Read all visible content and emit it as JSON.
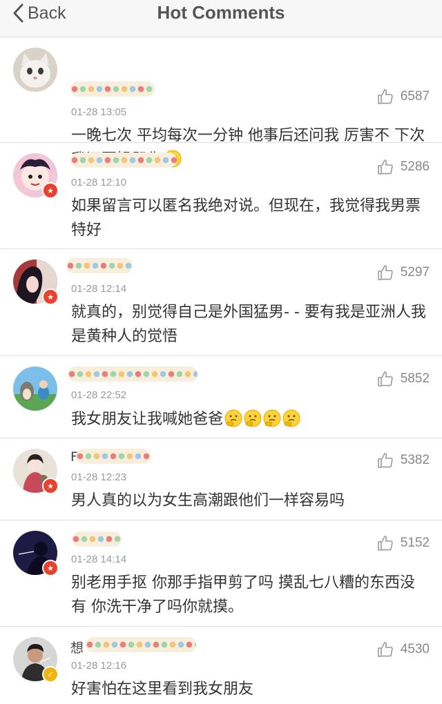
{
  "header": {
    "back_label": "Back",
    "title": "Hot Comments"
  },
  "comments": [
    {
      "time": "01-28 13:05",
      "likes": "6587",
      "text": "一晚七次 平均每次一分钟 他事后还问我 厉害不 下次我还要操哭你",
      "emoji": "smile",
      "emoji_count": 1,
      "badge": "",
      "name_prefix": ""
    },
    {
      "time": "01-28 12:10",
      "likes": "5286",
      "text": "如果留言可以匿名我绝对说。但现在，我觉得我男票特好",
      "emoji": "",
      "emoji_count": 0,
      "badge": "red",
      "name_prefix": ""
    },
    {
      "time": "01-28 12:14",
      "likes": "5297",
      "text": "就真的，别觉得自己是外国猛男- - 要有我是亚洲人我是黄种人的觉悟",
      "emoji": "",
      "emoji_count": 0,
      "badge": "red",
      "name_prefix": ""
    },
    {
      "time": "01-28 22:52",
      "likes": "5852",
      "text": "我女朋友让我喊她爸爸",
      "emoji": "think",
      "emoji_count": 4,
      "badge": "",
      "name_prefix": ""
    },
    {
      "time": "01-28 12:23",
      "likes": "5382",
      "text": "男人真的以为女生高潮跟他们一样容易吗",
      "emoji": "",
      "emoji_count": 0,
      "badge": "red",
      "name_prefix": "F"
    },
    {
      "time": "01-28 14:14",
      "likes": "5152",
      "text": "别老用手抠 你那手指甲剪了吗  摸乱七八糟的东西没有   你洗干净了吗你就摸。",
      "emoji": "",
      "emoji_count": 0,
      "badge": "red",
      "name_prefix": ""
    },
    {
      "time": "01-28 12:16",
      "likes": "4530",
      "text": "好害怕在这里看到我女朋友",
      "emoji": "",
      "emoji_count": 0,
      "badge": "gold",
      "name_prefix": "想"
    }
  ]
}
